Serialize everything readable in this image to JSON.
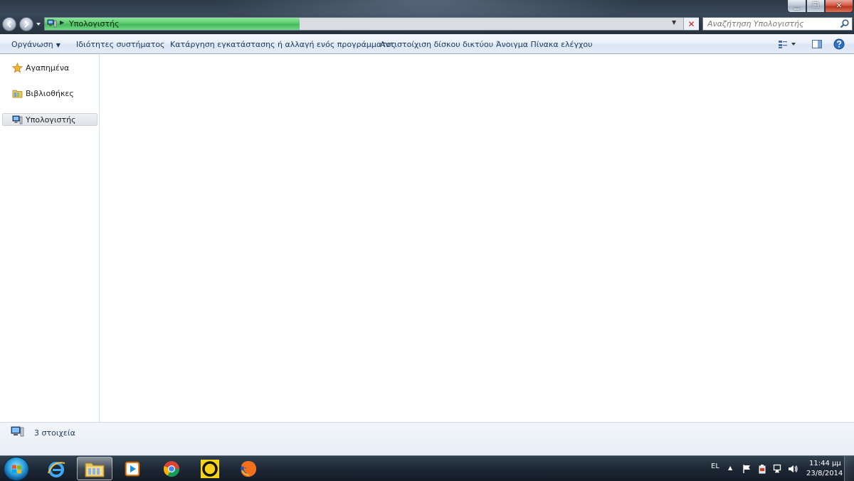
{
  "window": {
    "caption_minimize": "▁",
    "caption_maximize": "❐",
    "caption_close": "✕"
  },
  "address": {
    "path": "Υπολογιστής",
    "separator": "▶",
    "dropdown": "▼",
    "stop": "✕",
    "load_progress_percent": 39
  },
  "search": {
    "placeholder": "Αναζήτηση Υπολογιστής"
  },
  "commands": {
    "organize": "Οργάνωση",
    "organize_arrow": "▼",
    "system_properties": "Ιδιότητες συστήματος",
    "uninstall": "Κατάργηση εγκατάστασης ή αλλαγή ενός προγράμματος",
    "map_drive": "Αντιστοίχιση δίσκου δικτύου",
    "control_panel": "Άνοιγμα Πίνακα ελέγχου"
  },
  "nav": {
    "favorites": "Αγαπημένα",
    "libraries": "Βιβλιοθήκες",
    "computer": "Υπολογιστής"
  },
  "details": {
    "count_text": "3 στοιχεία"
  },
  "taskbar": {
    "language": "EL",
    "tray_expand": "▲",
    "time": "11:44 μμ",
    "date": "23/8/2014"
  },
  "colors": {
    "address_progress": "#56c96a",
    "taskbar": "#1d2835",
    "command_bar": "#e9f0f8"
  },
  "icons": {
    "back": "back-arrow-icon",
    "forward": "forward-arrow-icon",
    "computer": "computer-icon",
    "search": "search-icon",
    "favorites": "star-icon",
    "libraries": "library-folder-icon",
    "help": "help-icon",
    "views": "view-options-icon",
    "preview": "preview-pane-icon"
  }
}
